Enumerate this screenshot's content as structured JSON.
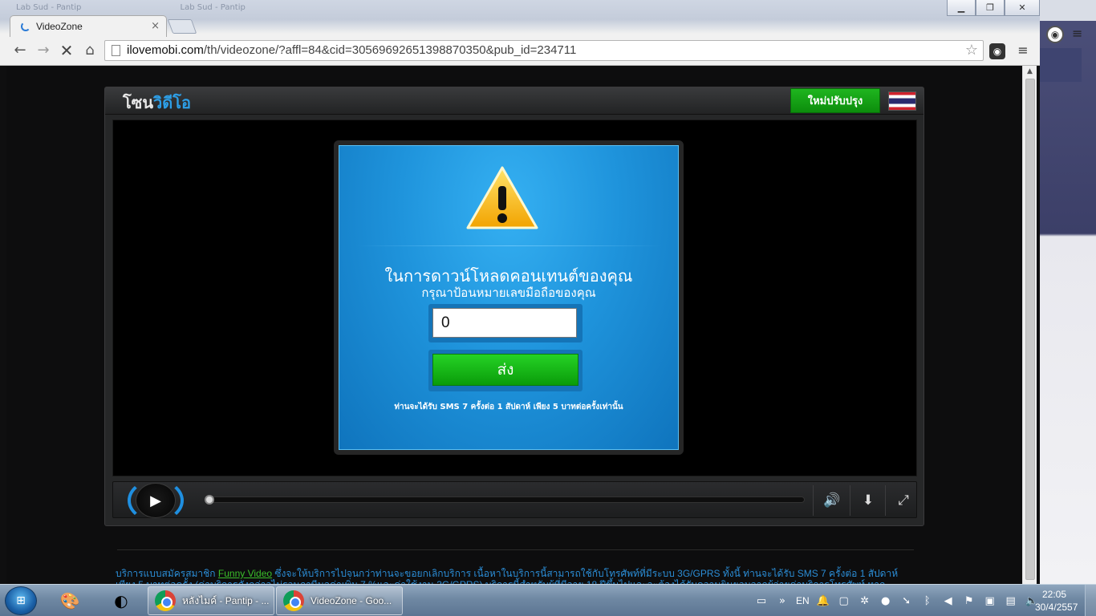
{
  "browser": {
    "bg_tabs": [
      "Lab Sud - Pantip",
      "Lab Sud - Pantip"
    ],
    "active_tab": {
      "title": "VideoZone"
    },
    "url_host": "ilovemobi.com",
    "url_path": "/th/videozone/?affl=84&cid=30569692651398870350&pub_id=234711",
    "icons": {
      "back": "back-arrow-icon",
      "forward": "forward-arrow-icon",
      "stop": "stop-icon",
      "home": "home-icon",
      "star": "bookmark-star-icon",
      "menu": "hamburger-menu-icon"
    }
  },
  "site": {
    "brand_main": "โซน",
    "brand_accent": "วิดีโอ",
    "update_button": "ใหม่ปรับปรุง",
    "accent_color": "#2d9ee6"
  },
  "dialog": {
    "line1": "ในการดาวน์โหลดคอนเทนต์ของคุณ",
    "line2": "กรุณาป้อนหมายเลขมือถือของคุณ",
    "phone_value": "0",
    "send_label": "ส่ง",
    "sms_note": "ท่านจะได้รับ SMS 7 ครั้งต่อ 1 สัปดาห์ เพียง 5 บาทต่อครั้งเท่านั้น"
  },
  "player": {
    "progress": 0
  },
  "footer": {
    "prefix": "บริการแบบสมัครสมาชิก ",
    "link": "Funny Video",
    "rest": " ซึ่งจะให้บริการไปจนกว่าท่านจะขอยกเลิกบริการ เนื้อหาในบริการนี้สามารถใช้กับโทรศัพท์ที่มีระบบ 3G/GPRS ทั้งนี้ ท่านจะได้รับ SMS 7 ครั้งต่อ 1 สัปดาห์ เพียง 5 บาทต่อครั้ง (ค่าบริการดังกล่าวไม่รวมภาษีมูลค่าเพิ่ม 7 %และค่าใช้งาน 3G/GPRS) บริการนี้สำหรับผู้ที่มีอายุ 18 ปีขึ้นไปและจะต้องได้รับความยินยอมจากผู้จ่ายค่าบริการโทรศัพท์ หากต้องการหยุดใช้บริการพิมพ์ \"STOP XA\""
  },
  "taskbar": {
    "tasks": [
      {
        "label": "หลังไมค์ - Pantip - ..."
      },
      {
        "label": "VideoZone - Goo..."
      }
    ],
    "lang": "EN",
    "time": "22:05",
    "date": "30/4/2557"
  }
}
